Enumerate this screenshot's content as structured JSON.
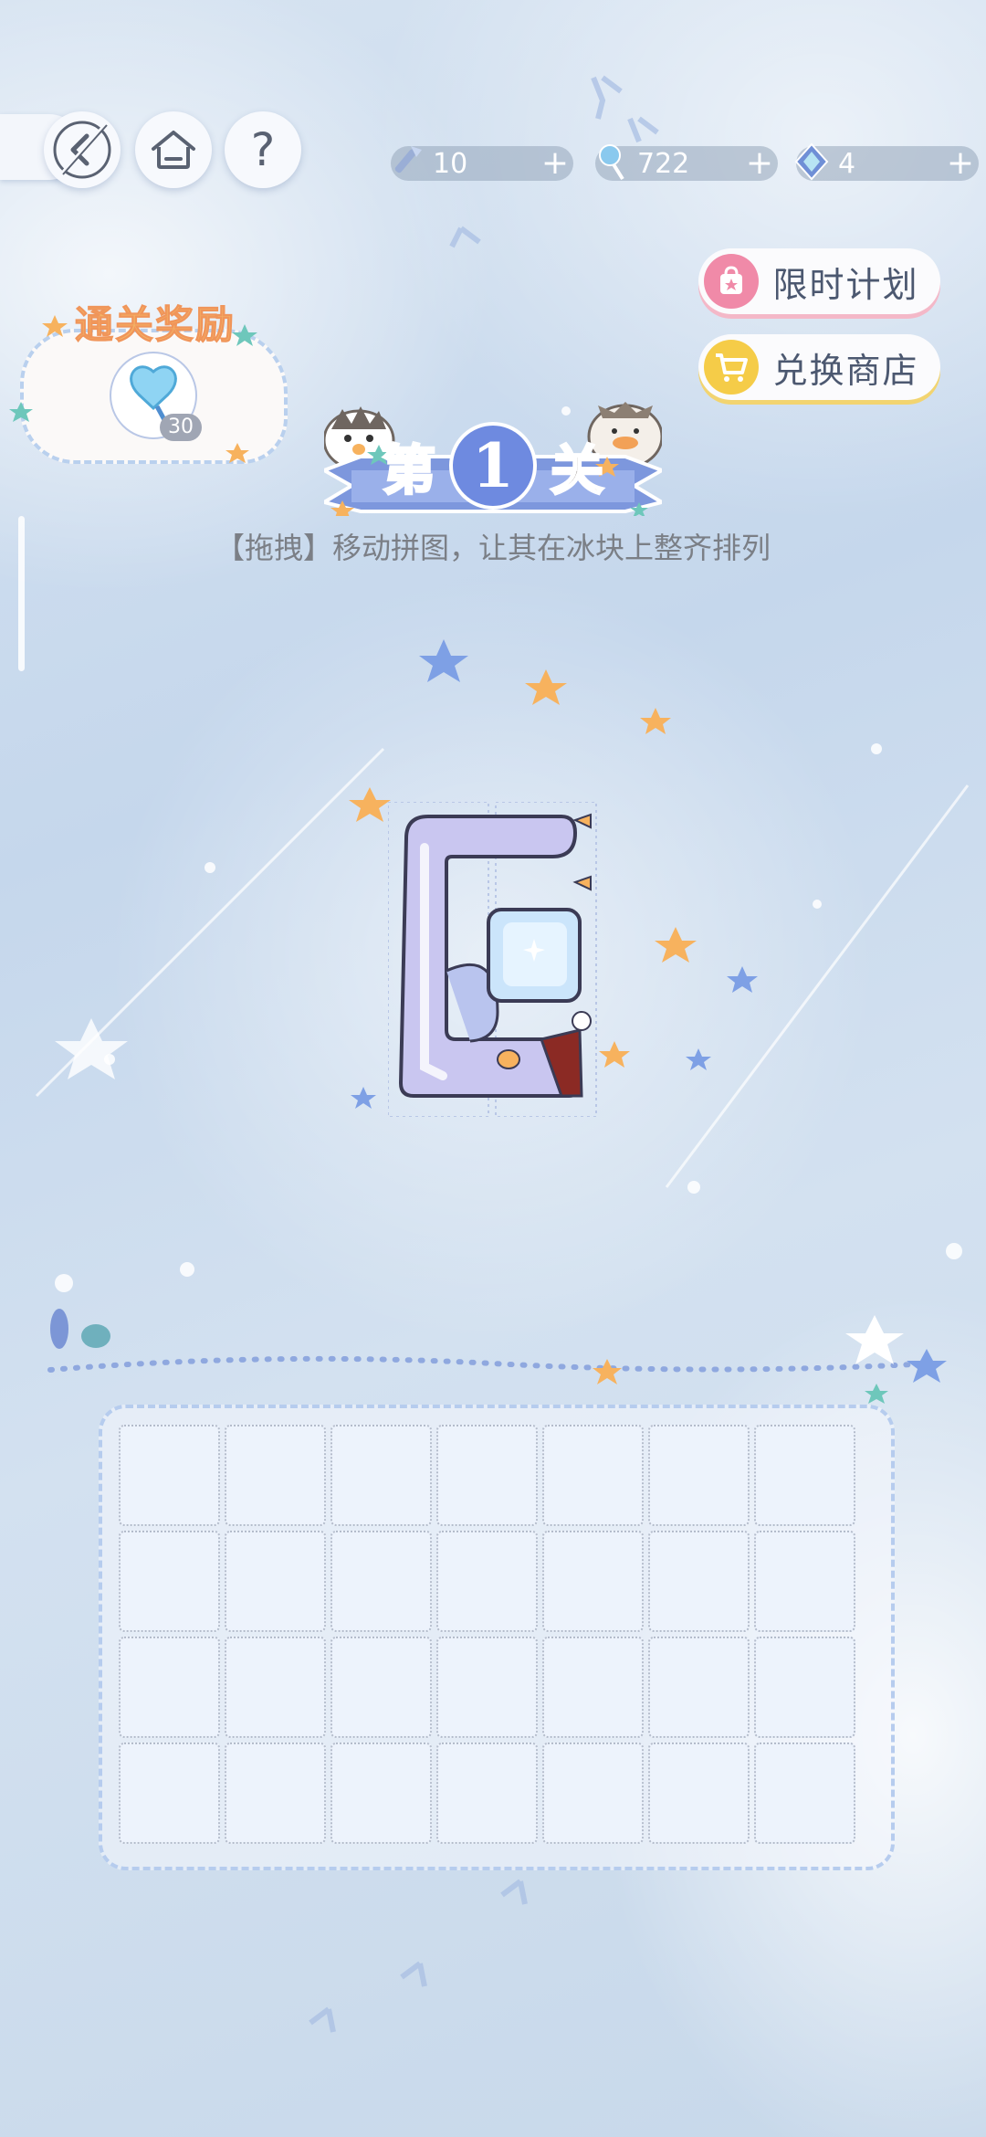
{
  "top_bar": {
    "back_icon": "back-arrow-icon",
    "home_icon": "home-icon",
    "help_label": "?",
    "currencies": [
      {
        "icon": "ice-pick-icon",
        "value": "10",
        "plus": "+"
      },
      {
        "icon": "lollipop-icon",
        "value": "722",
        "plus": "+"
      },
      {
        "icon": "crystal-icon",
        "value": "4",
        "plus": "+"
      }
    ]
  },
  "side_menu": {
    "limited_plan": "限时计划",
    "exchange_shop": "兑换商店"
  },
  "reward": {
    "title": "通关奖励",
    "count": "30"
  },
  "level": {
    "prefix": "第",
    "number": "1",
    "suffix": "关",
    "instruction": "【拖拽】移动拼图，让其在冰块上整齐排列"
  },
  "board": {
    "rows": 4,
    "cols": 7
  },
  "colors": {
    "banner_blue": "#7d97dd",
    "penguin_purple": "#c9c6f0",
    "accent_orange": "#f7b25e",
    "pink_accent": "#f08aa8",
    "yellow_accent": "#f5cc48"
  }
}
